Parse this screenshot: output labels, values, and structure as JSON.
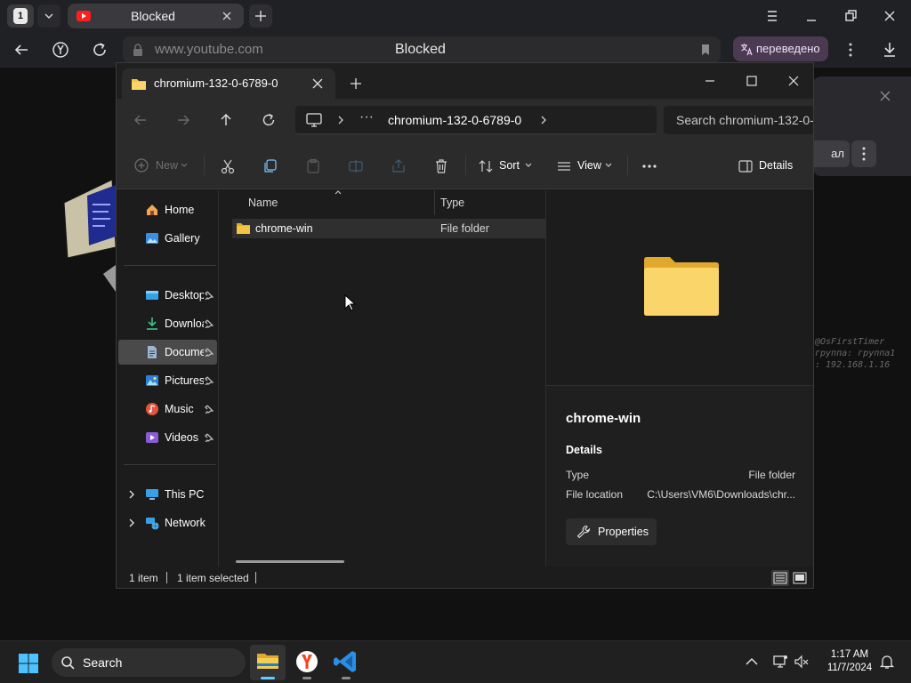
{
  "browser": {
    "tab_counter": "1",
    "tab_title": "Blocked",
    "url": "www.youtube.com",
    "page_title": "Blocked",
    "translate_label": "переведено",
    "bg_button_label": "ал",
    "bg_terminal_lines": [
      "@OsFirstTimer",
      "группа: группа1",
      ": 192.168.1.16"
    ]
  },
  "explorer": {
    "tab_title": "chromium-132-0-6789-0",
    "breadcrumb": "chromium-132-0-6789-0",
    "search_placeholder": "Search chromium-132-0-6789-0",
    "commands": {
      "new": "New",
      "sort": "Sort",
      "view": "View",
      "details": "Details"
    },
    "nav": {
      "home": "Home",
      "gallery": "Gallery",
      "desktop": "Desktop",
      "downloads": "Downloads",
      "documents": "Documents",
      "pictures": "Pictures",
      "music": "Music",
      "videos": "Videos",
      "this_pc": "This PC",
      "network": "Network"
    },
    "columns": {
      "name": "Name",
      "type": "Type"
    },
    "files": [
      {
        "name": "chrome-win",
        "type": "File folder"
      }
    ],
    "details": {
      "name": "chrome-win",
      "section": "Details",
      "type_key": "Type",
      "type_value": "File folder",
      "location_key": "File location",
      "location_value": "C:\\Users\\VM6\\Downloads\\chr...",
      "properties": "Properties"
    },
    "status": {
      "count": "1 item",
      "selection": "1 item selected"
    }
  },
  "taskbar": {
    "search_label": "Search",
    "time": "1:17 AM",
    "date": "11/7/2024"
  },
  "colors": {
    "folder": "#f4c542",
    "accent": "#60cdff",
    "translate_bg": "#4b3a52"
  }
}
